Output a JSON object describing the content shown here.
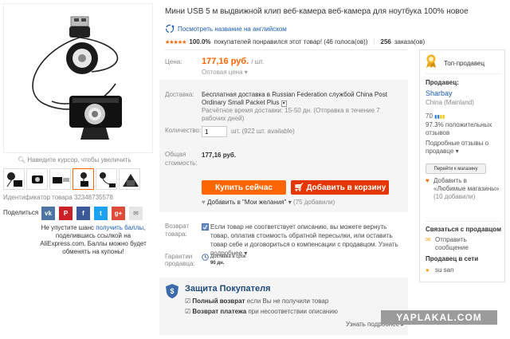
{
  "product": {
    "title": "Мини USB 5 м выдвижной клип веб-камера веб-камера для ноутбука 100% новое",
    "translate_link": "Посмотреть название на английском",
    "rating": {
      "positive_pct": "100.0%",
      "positive_text": "покупателей понравился этот товар! (46 голоса(ов))",
      "orders_count": "256",
      "orders_label": "заказа(ов)"
    },
    "zoom_hint": "Наведите курсор, чтобы увеличить",
    "product_id": "Идентификатор товара 32348735578"
  },
  "share": {
    "label": "Поделиться",
    "buttons": [
      "vk-icon",
      "pinterest-icon",
      "facebook-icon",
      "twitter-icon",
      "googleplus-icon",
      "email-icon"
    ],
    "text_before": "Не упустите шанс",
    "text_link": "получить баллы",
    "text_after": ", поделившись ссылкой на AliExpress.com. Баллы можно будет обменять на купоны!"
  },
  "price_block": {
    "label": "Цена:",
    "price": "177,16 руб.",
    "unit": "/ шт.",
    "wholesale": "Оптовая цена ▾"
  },
  "shipping": {
    "label": "Доставка:",
    "main": "Бесплатная доставка в Russian Federation службой China Post Ordinary Small Packet Plus",
    "time": "Расчётное время доставки: 15-50 дн. (Отправка в течение 7 рабочих дней)"
  },
  "quantity": {
    "label": "Количество:",
    "value": "1",
    "available": "шт. (922 шт. available)"
  },
  "total": {
    "label": "Общая стоимость:",
    "value": "177,16 руб."
  },
  "actions": {
    "buy_now": "Купить сейчас",
    "add_to_cart": "Добавить в корзину",
    "wishlist": "Добавить в \"Мои желания\"",
    "wishlist_count": "(75 добавили)"
  },
  "returns": {
    "label": "Возврат товара:",
    "text": "Если товар не соответствует описанию, вы можете вернуть товар, оплатив стоимость обратной пересылки, или оставить товар себе и договориться о компенсации с продавцом.",
    "more": "Узнать подробнее ▾"
  },
  "guarantee": {
    "label": "Гарантии продавца:",
    "line1": "Доставка в срок",
    "line2": "90 дн."
  },
  "protection": {
    "title": "Защита Покупателя",
    "item1_bold": "Полный возврат",
    "item1_rest": "если Вы не получили товар",
    "item2_bold": "Возврат платежа",
    "item2_rest": "при несоответствии описанию",
    "more": "Узнать подробнее ▸"
  },
  "seller": {
    "badge": "Топ-продавец",
    "seller_label": "Продавец:",
    "name": "Sharbay",
    "location": "China (Mainland)",
    "score": "70",
    "positive": "97.3% положительных отзывов",
    "details": "Подробные отзывы о продавце ▾",
    "go_store": "Перейти к магазину",
    "add_fav": "Добавить в «Любимые магазины»",
    "add_fav_count": "(10 добавили)",
    "contact_head": "Связаться с продавцом",
    "send_msg": "Отправить сообщение",
    "online_head": "Продавец в сети",
    "online_user": "su san"
  },
  "watermark": "YAPLAKAL.COM",
  "colors": {
    "accent_orange": "#ff6600",
    "cart_red": "#e63600",
    "link_blue": "#1a5bb5",
    "protect_blue": "#1e4b7c"
  }
}
